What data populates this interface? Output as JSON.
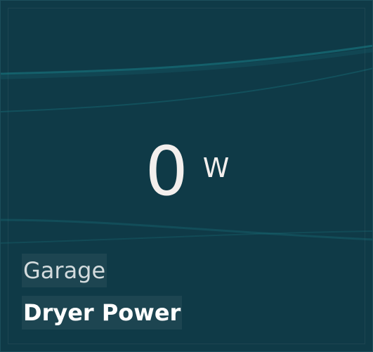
{
  "tile": {
    "value": "0",
    "unit": "W",
    "location": "Garage",
    "name": "Dryer Power"
  },
  "colors": {
    "background": "#0f3a47",
    "wave": "#1a7f86",
    "text": "#f3efed"
  }
}
